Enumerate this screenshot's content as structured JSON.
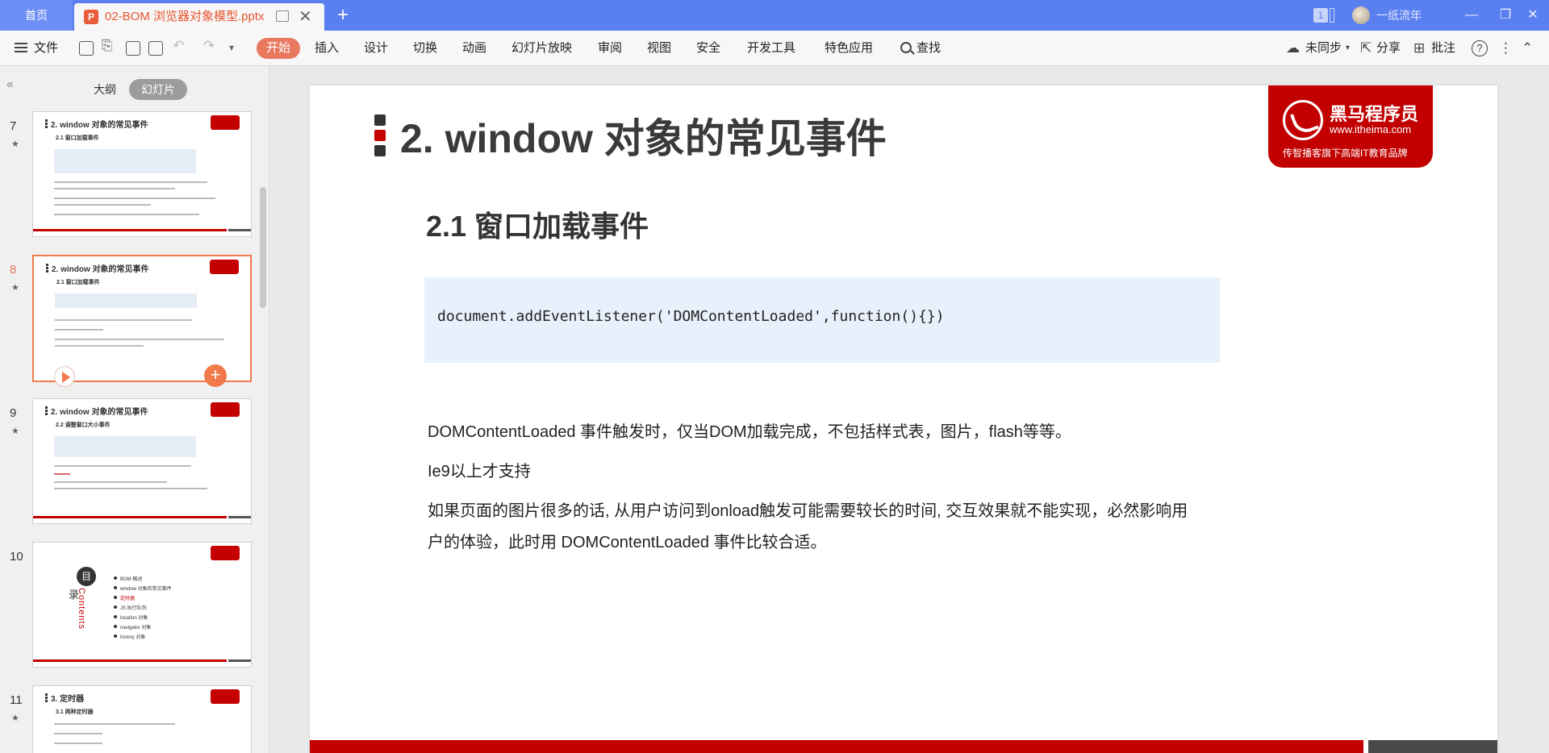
{
  "titlebar": {
    "home_tab": "首页",
    "doc_icon": "P",
    "doc_title": "02-BOM 浏览器对象模型.pptx",
    "new_tab": "+",
    "badge": "1",
    "user_name": "一纸流年",
    "minimize": "—",
    "restore": "❐",
    "close": "✕",
    "tab_close": "✕"
  },
  "ribbon": {
    "file_label": "文件",
    "tabs": [
      "开始",
      "插入",
      "设计",
      "切换",
      "动画",
      "幻灯片放映",
      "审阅",
      "视图",
      "安全",
      "开发工具",
      "特色应用"
    ],
    "search_label": "查找",
    "sync_label": "未同步",
    "share_label": "分享",
    "comment_label": "批注",
    "help_glyph": "?",
    "more_glyph": "⋮",
    "collapse_glyph": "⌃"
  },
  "left_panel": {
    "collapse_glyph": "«",
    "outline_label": "大纲",
    "slides_label": "幻灯片",
    "slides": [
      {
        "num": "7",
        "title": "2. window 对象的常见事件",
        "subtitle": "2.1 窗口加载事件"
      },
      {
        "num": "8",
        "title": "2. window 对象的常见事件",
        "subtitle": "2.1 窗口加载事件"
      },
      {
        "num": "9",
        "title": "2. window 对象的常见事件",
        "subtitle": "2.2 调整窗口大小事件"
      },
      {
        "num": "10",
        "toc_circle": "目",
        "toc_lu": "录",
        "toc_contents": "Contents",
        "toc_items": [
          "BOM 概述",
          "window 对象的常见事件",
          "定时器",
          "JS 执行队列",
          "location 对象",
          "navigator 对象",
          "history 对象"
        ]
      },
      {
        "num": "11",
        "title": "3. 定时器",
        "subtitle": "3.1 两种定时器"
      }
    ],
    "star_glyph": "★"
  },
  "slide": {
    "title": "2. window 对象的常见事件",
    "logo": {
      "name": "黑马程序员",
      "url": "www.itheima.com",
      "tagline": "传智播客旗下高端IT教育品牌"
    },
    "subtitle": "2.1 窗口加载事件",
    "code": "document.addEventListener('DOMContentLoaded',function(){})",
    "para1": "DOMContentLoaded 事件触发时，仅当DOM加载完成，不包括样式表，图片，flash等等。",
    "para2": "Ie9以上才支持",
    "para3_line1": "如果页面的图片很多的话, 从用户访问到onload触发可能需要较长的时间, 交互效果就不能实现，必然影响用",
    "para3_line2": "户的体验，此时用 DOMContentLoaded 事件比较合适。"
  },
  "colors": {
    "titlebar": "#5a7ff0",
    "accent_orange": "#e8785e",
    "brand_red": "#c20000"
  }
}
